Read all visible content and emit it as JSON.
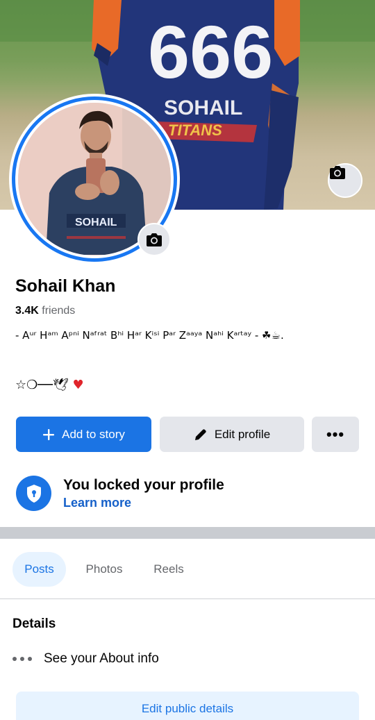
{
  "profile": {
    "name": "Sohail Khan",
    "friends_count": "3.4K",
    "friends_label": "friends",
    "bio_line1": "- Aᵘʳ Hᵃᵐ Aᵖⁿⁱ Nᵃᶠʳᵃᵗ Bʰⁱ Hᵃʳ Kⁱˢⁱ Pᵃʳ Zᵃᵃʸᵃ Nᵃʰⁱ Kᵃʳᵗᵃʸ - ☘☕.",
    "bio_line2": "☆❍──🕊",
    "bio_heart": "♥"
  },
  "cover": {
    "jersey_number": "666",
    "jersey_name": "SOHAIL",
    "jersey_team": "TITANS"
  },
  "avatar": {
    "shirt_text": "SOHAIL"
  },
  "actions": {
    "add_story": "Add to story",
    "edit_profile": "Edit profile",
    "more": "•••"
  },
  "lock": {
    "title": "You locked your profile",
    "link": "Learn more"
  },
  "tabs": [
    {
      "label": "Posts",
      "active": true
    },
    {
      "label": "Photos",
      "active": false
    },
    {
      "label": "Reels",
      "active": false
    }
  ],
  "details": {
    "title": "Details",
    "about": "See your About info",
    "edit_public": "Edit public details"
  },
  "colors": {
    "accent": "#1b74e4",
    "ring": "#1877f2",
    "button_gray": "#e4e6eb",
    "heart": "#e0242b"
  },
  "icons": [
    "camera-icon",
    "plus-icon",
    "pencil-icon",
    "more-dots-icon",
    "shield-lock-icon",
    "about-dots-icon"
  ]
}
